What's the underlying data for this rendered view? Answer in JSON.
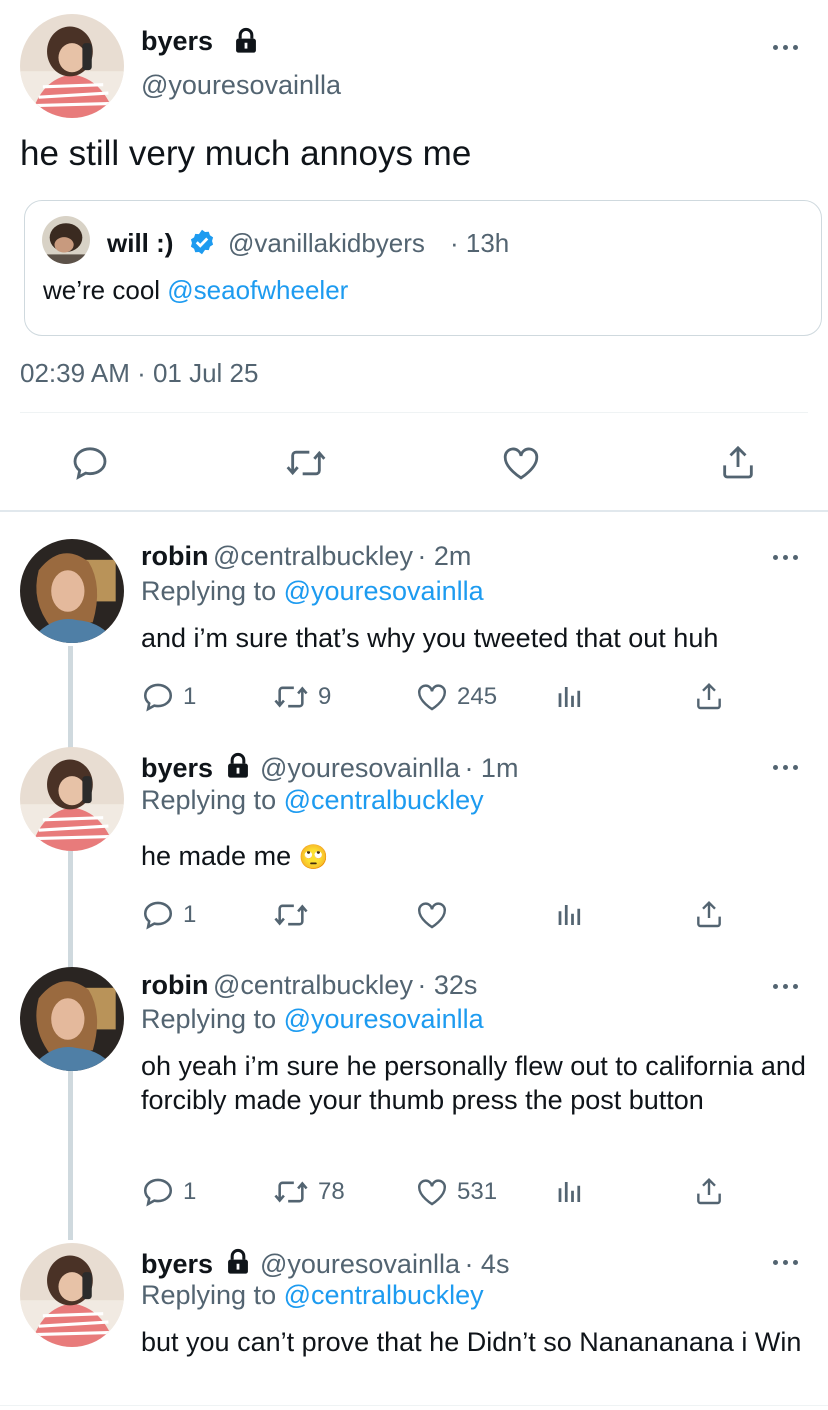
{
  "main_tweet": {
    "name": "byers",
    "handle": "@youresovainlla",
    "text": "he still very much annoys me",
    "timestamp": "02:39 AM · 01 Jul 25",
    "quote": {
      "name": "will :)",
      "handle": "@vanillakidbyers",
      "time": "· 13h",
      "text_prefix": "we’re cool ",
      "mention": "@seaofwheeler"
    }
  },
  "replies": [
    {
      "name": "robin",
      "handle": "@centralbuckley",
      "time": "· 2m",
      "replying_label": "Replying to ",
      "replying_to": "@youresovainlla",
      "text": "and i’m sure that’s why you tweeted that out huh",
      "reply_count": "1",
      "retweet_count": "9",
      "like_count": "245"
    },
    {
      "name": "byers",
      "handle": "@youresovainlla",
      "time": "· 1m",
      "replying_label": "Replying to ",
      "replying_to": "@centralbuckley",
      "text": "he made me",
      "emoji": "🙄",
      "reply_count": "1",
      "retweet_count": "",
      "like_count": ""
    },
    {
      "name": "robin",
      "handle": "@centralbuckley",
      "time": "· 32s",
      "replying_label": "Replying to ",
      "replying_to": "@youresovainlla",
      "text": "oh yeah i’m sure he personally flew out to california and forcibly made your thumb press the post button",
      "reply_count": "1",
      "retweet_count": "78",
      "like_count": "531"
    },
    {
      "name": "byers",
      "handle": "@youresovainlla",
      "time": "· 4s",
      "replying_label": "Replying to ",
      "replying_to": "@centralbuckley",
      "text": "but you can’t prove that he Didn’t so Nanananana i Win"
    }
  ],
  "colors": {
    "link": "#1d9bf0",
    "secondary_text": "#536471",
    "thread_line": "#cfd9de"
  }
}
